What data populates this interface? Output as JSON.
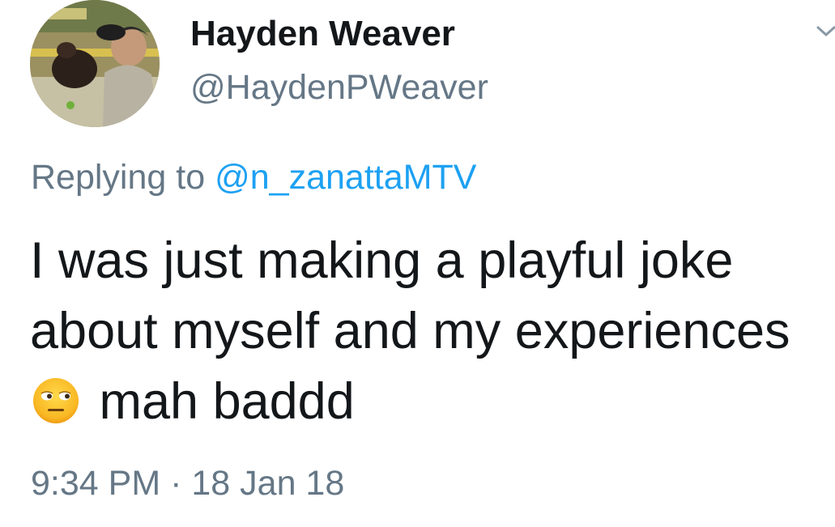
{
  "author": {
    "display_name": "Hayden Weaver",
    "handle": "@HaydenPWeaver"
  },
  "reply": {
    "prefix": "Replying to",
    "mention": "@n_zanattaMTV"
  },
  "tweet": {
    "text_part1": "I was just making a playful joke about myself and my experiences",
    "emoji_name": "neutral-face-side-eye-emoji",
    "text_part2": "mah baddd"
  },
  "meta": {
    "time": "9:34 PM",
    "separator": "·",
    "date": "18 Jan 18"
  },
  "colors": {
    "primary_text": "#14171a",
    "secondary_text": "#657786",
    "link": "#1da1f2",
    "background": "#ffffff"
  },
  "icons": {
    "menu": "chevron-down-icon"
  }
}
